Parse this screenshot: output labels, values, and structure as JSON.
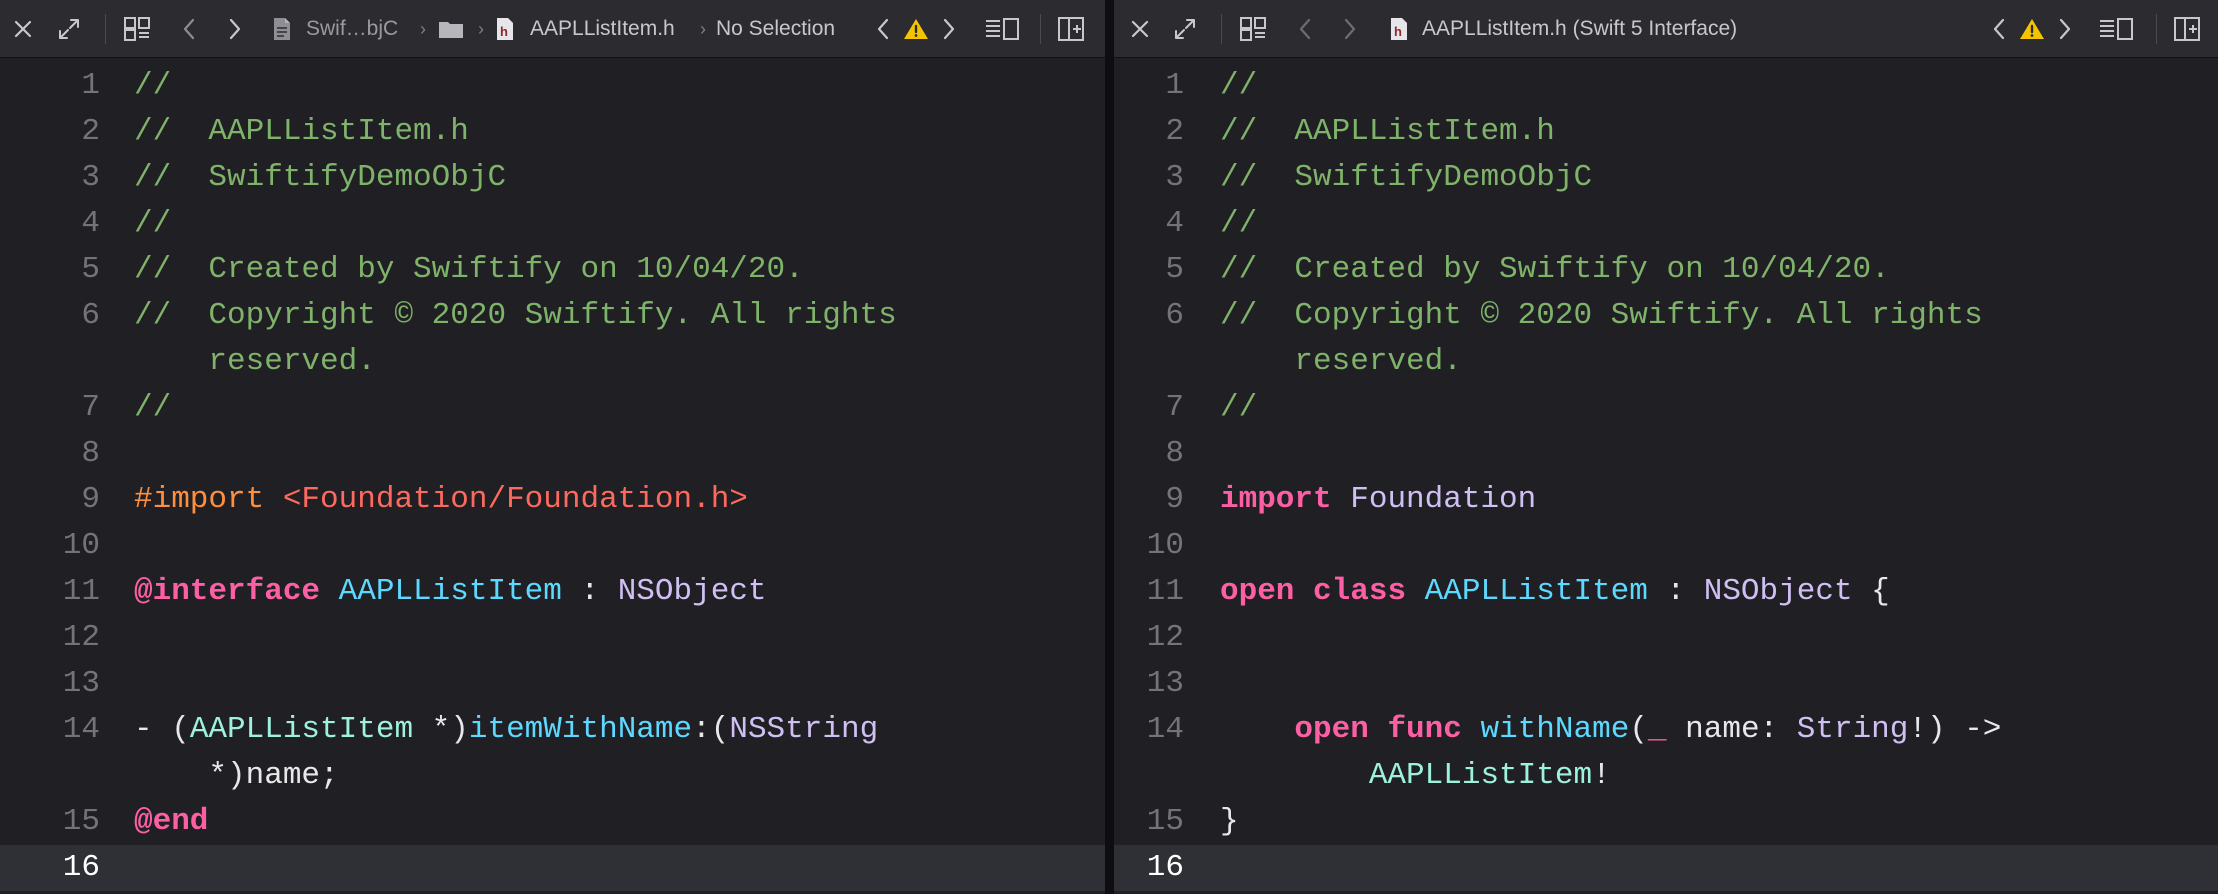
{
  "left_pane": {
    "breadcrumb": {
      "project": "Swif…bjC",
      "file": "AAPLListItem.h",
      "selection": "No Selection"
    },
    "lines": [
      {
        "n": "1",
        "tokens": [
          {
            "t": "//",
            "c": "comment"
          }
        ]
      },
      {
        "n": "2",
        "tokens": [
          {
            "t": "//  AAPLListItem.h",
            "c": "comment"
          }
        ]
      },
      {
        "n": "3",
        "tokens": [
          {
            "t": "//  SwiftifyDemoObjC",
            "c": "comment"
          }
        ]
      },
      {
        "n": "4",
        "tokens": [
          {
            "t": "//",
            "c": "comment"
          }
        ]
      },
      {
        "n": "5",
        "tokens": [
          {
            "t": "//  Created by Swiftify on 10/04/20.",
            "c": "comment"
          }
        ]
      },
      {
        "n": "6",
        "tokens": [
          {
            "t": "//  Copyright © 2020 Swiftify. All rights",
            "c": "comment"
          }
        ]
      },
      {
        "n": "",
        "tokens": [
          {
            "t": "    reserved.",
            "c": "comment"
          }
        ]
      },
      {
        "n": "7",
        "tokens": [
          {
            "t": "//",
            "c": "comment"
          }
        ]
      },
      {
        "n": "8",
        "tokens": []
      },
      {
        "n": "9",
        "tokens": [
          {
            "t": "#import ",
            "c": "pre"
          },
          {
            "t": "<Foundation/Foundation.h>",
            "c": "prestr"
          }
        ]
      },
      {
        "n": "10",
        "tokens": []
      },
      {
        "n": "11",
        "tokens": [
          {
            "t": "@interface",
            "c": "kw"
          },
          {
            "t": " ",
            "c": "plain"
          },
          {
            "t": "AAPLListItem",
            "c": "type"
          },
          {
            "t": " : ",
            "c": "plain"
          },
          {
            "t": "NSObject",
            "c": "ext"
          }
        ]
      },
      {
        "n": "12",
        "tokens": []
      },
      {
        "n": "13",
        "tokens": []
      },
      {
        "n": "14",
        "tokens": [
          {
            "t": "- (",
            "c": "plain"
          },
          {
            "t": "AAPLListItem",
            "c": "teal"
          },
          {
            "t": " *)",
            "c": "plain"
          },
          {
            "t": "itemWithName",
            "c": "type"
          },
          {
            "t": ":(",
            "c": "plain"
          },
          {
            "t": "NSString",
            "c": "ext"
          }
        ]
      },
      {
        "n": "",
        "tokens": [
          {
            "t": "    *)name;",
            "c": "plain"
          }
        ]
      },
      {
        "n": "15",
        "tokens": [
          {
            "t": "@end",
            "c": "kw"
          }
        ]
      },
      {
        "n": "16",
        "tokens": [],
        "current": true
      }
    ]
  },
  "right_pane": {
    "title": "AAPLListItem.h (Swift 5 Interface)",
    "lines": [
      {
        "n": "1",
        "tokens": [
          {
            "t": "//",
            "c": "comment"
          }
        ]
      },
      {
        "n": "2",
        "tokens": [
          {
            "t": "//  AAPLListItem.h",
            "c": "comment"
          }
        ]
      },
      {
        "n": "3",
        "tokens": [
          {
            "t": "//  SwiftifyDemoObjC",
            "c": "comment"
          }
        ]
      },
      {
        "n": "4",
        "tokens": [
          {
            "t": "//",
            "c": "comment"
          }
        ]
      },
      {
        "n": "5",
        "tokens": [
          {
            "t": "//  Created by Swiftify on 10/04/20.",
            "c": "comment"
          }
        ]
      },
      {
        "n": "6",
        "tokens": [
          {
            "t": "//  Copyright © 2020 Swiftify. All rights",
            "c": "comment"
          }
        ]
      },
      {
        "n": "",
        "tokens": [
          {
            "t": "    reserved.",
            "c": "comment"
          }
        ]
      },
      {
        "n": "7",
        "tokens": [
          {
            "t": "//",
            "c": "comment"
          }
        ]
      },
      {
        "n": "8",
        "tokens": []
      },
      {
        "n": "9",
        "tokens": [
          {
            "t": "import",
            "c": "kw"
          },
          {
            "t": " ",
            "c": "plain"
          },
          {
            "t": "Foundation",
            "c": "ext"
          }
        ]
      },
      {
        "n": "10",
        "tokens": []
      },
      {
        "n": "11",
        "tokens": [
          {
            "t": "open",
            "c": "kw"
          },
          {
            "t": " ",
            "c": "plain"
          },
          {
            "t": "class",
            "c": "kw"
          },
          {
            "t": " ",
            "c": "plain"
          },
          {
            "t": "AAPLListItem",
            "c": "type"
          },
          {
            "t": " : ",
            "c": "plain"
          },
          {
            "t": "NSObject",
            "c": "ext"
          },
          {
            "t": " {",
            "c": "plain"
          }
        ]
      },
      {
        "n": "12",
        "tokens": []
      },
      {
        "n": "13",
        "tokens": []
      },
      {
        "n": "14",
        "tokens": [
          {
            "t": "    ",
            "c": "plain"
          },
          {
            "t": "open",
            "c": "kw"
          },
          {
            "t": " ",
            "c": "plain"
          },
          {
            "t": "func",
            "c": "kw"
          },
          {
            "t": " ",
            "c": "plain"
          },
          {
            "t": "withName",
            "c": "type"
          },
          {
            "t": "(",
            "c": "plain"
          },
          {
            "t": "_",
            "c": "kw"
          },
          {
            "t": " name: ",
            "c": "plain"
          },
          {
            "t": "String",
            "c": "ext"
          },
          {
            "t": "!) ->",
            "c": "plain"
          }
        ]
      },
      {
        "n": "",
        "tokens": [
          {
            "t": "        ",
            "c": "plain"
          },
          {
            "t": "AAPLListItem",
            "c": "teal"
          },
          {
            "t": "!",
            "c": "plain"
          }
        ]
      },
      {
        "n": "15",
        "tokens": [
          {
            "t": "}",
            "c": "plain"
          }
        ]
      },
      {
        "n": "16",
        "tokens": [],
        "current": true
      }
    ]
  },
  "colors": {
    "comment": "#7fb36a",
    "keyword": "#fc5fa3",
    "type": "#5dd8ff",
    "external_type": "#d0bff3",
    "preprocessor": "#fd8f3f",
    "preprocessor_string": "#fc6a5d",
    "warning": "#f5c400"
  },
  "icons": [
    "close-icon",
    "expand-icon",
    "related-items-icon",
    "back-icon",
    "forward-icon",
    "project-file-icon",
    "folder-icon",
    "header-file-icon",
    "warning-icon",
    "lines-icon",
    "add-editor-icon"
  ]
}
